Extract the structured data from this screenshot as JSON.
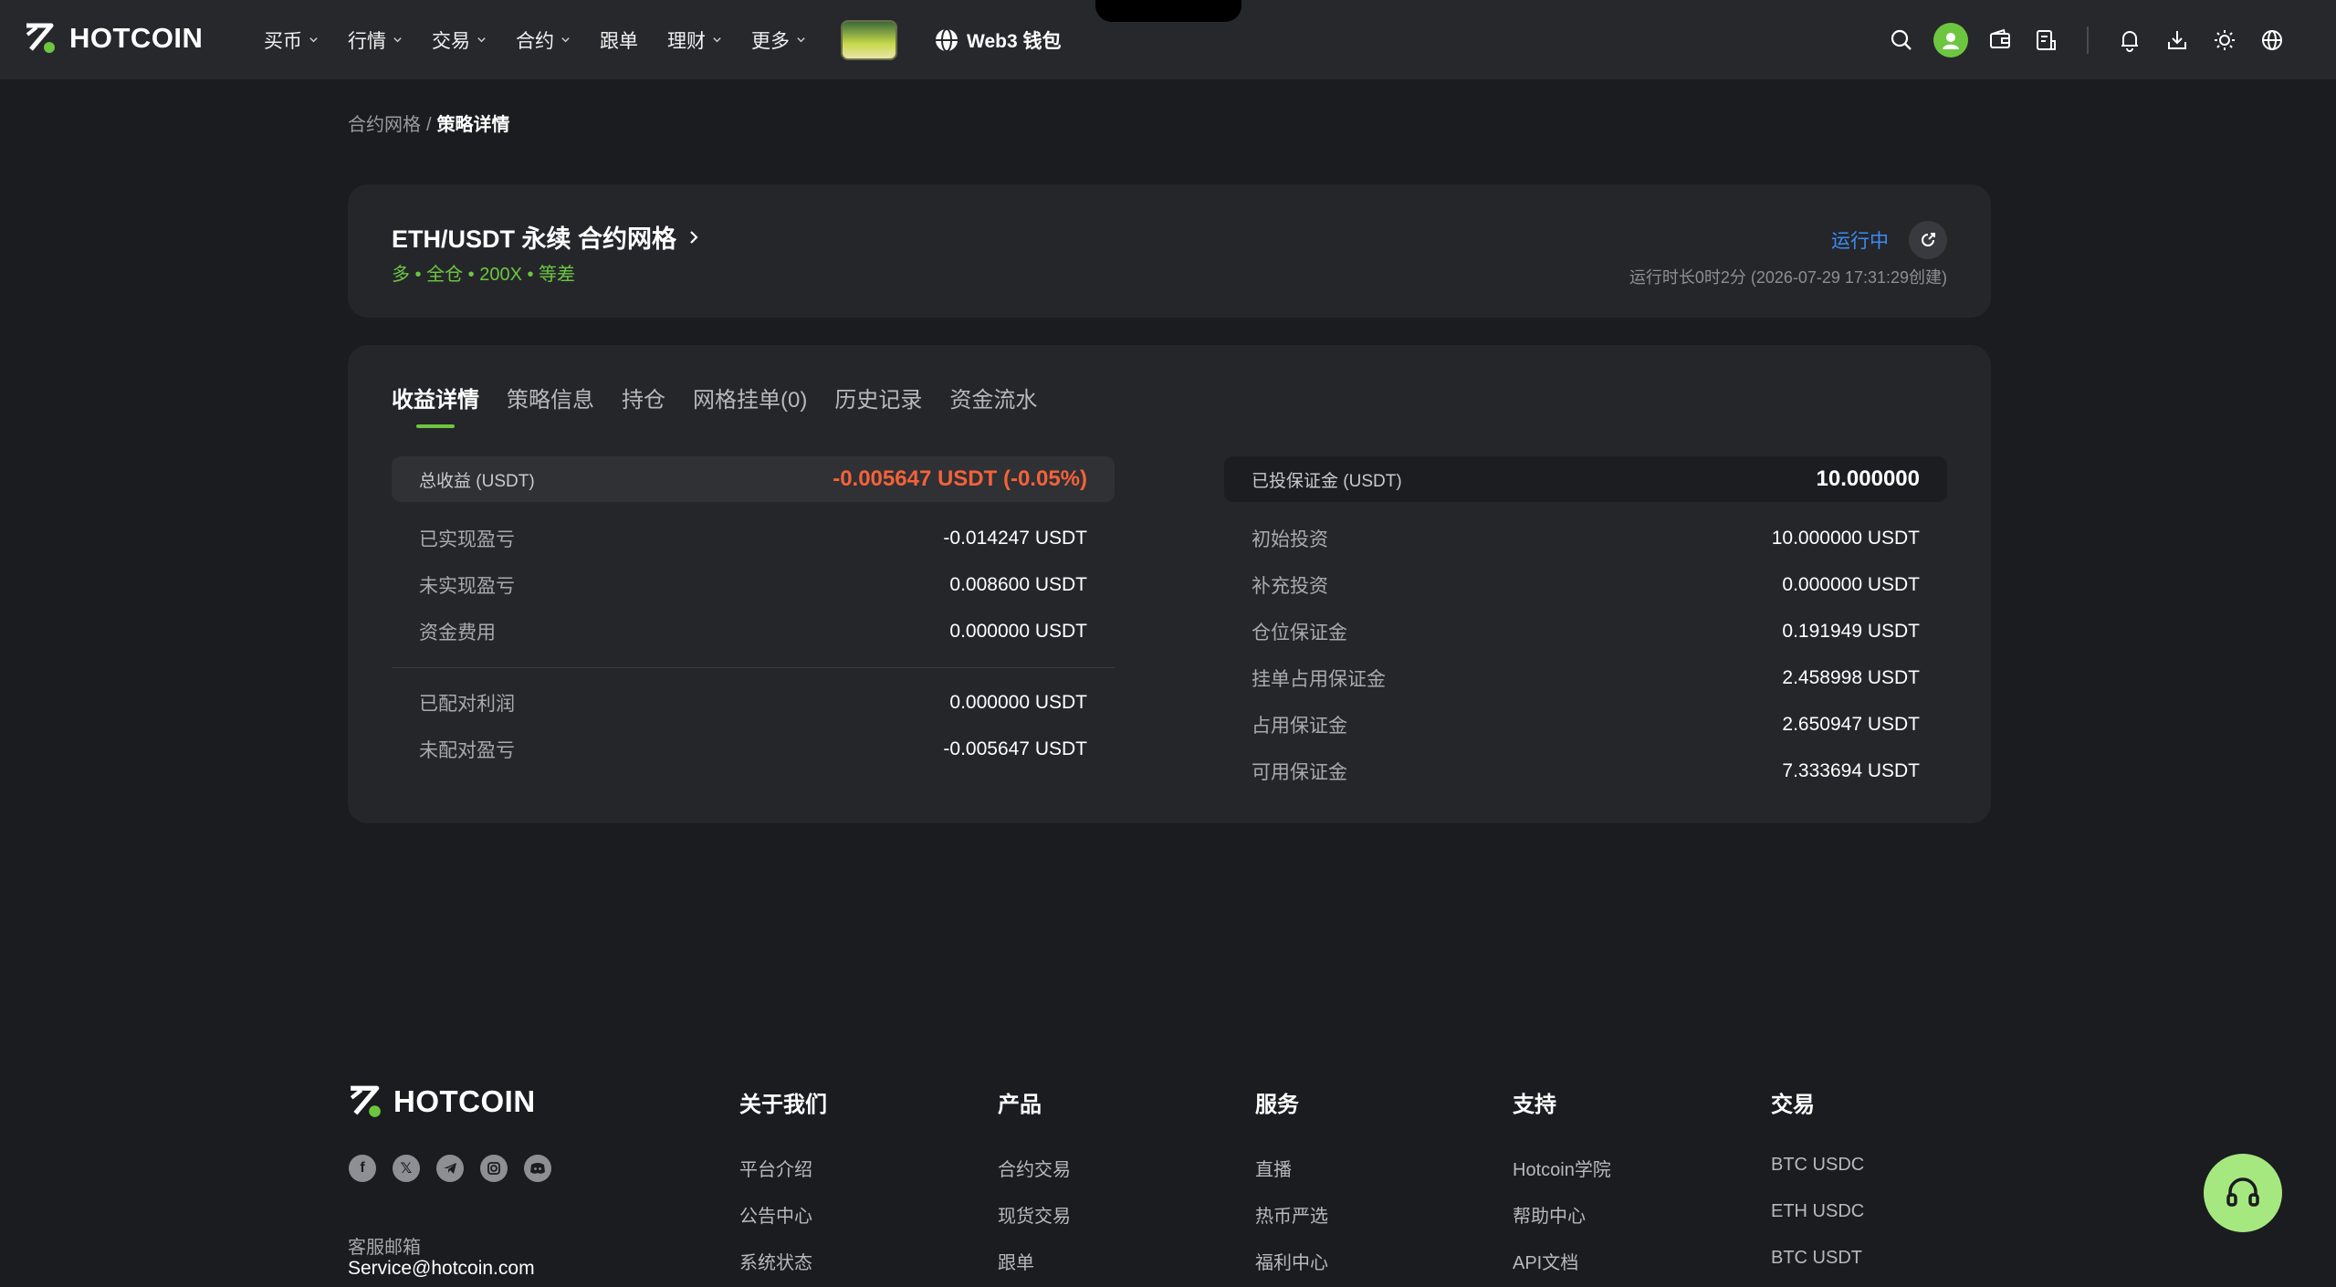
{
  "header": {
    "logo_text": "HOTCOIN",
    "nav": [
      {
        "label": "买币",
        "has_dropdown": true
      },
      {
        "label": "行情",
        "has_dropdown": true
      },
      {
        "label": "交易",
        "has_dropdown": true
      },
      {
        "label": "合约",
        "has_dropdown": true
      },
      {
        "label": "跟单",
        "has_dropdown": false
      },
      {
        "label": "理财",
        "has_dropdown": true
      },
      {
        "label": "更多",
        "has_dropdown": true
      }
    ],
    "web3_label": "Web3 钱包",
    "icons": [
      "search-icon",
      "avatar",
      "wallet-icon",
      "orders-icon",
      "bell-icon",
      "download-icon",
      "theme-icon",
      "globe-icon"
    ]
  },
  "breadcrumb": {
    "parent": "合约网格",
    "separator": "/",
    "current": "策略详情"
  },
  "summary": {
    "title": "ETH/USDT 永续 合约网格",
    "subtitle": "多 • 全仓 • 200X • 等差",
    "status": "运行中",
    "runtime": "运行时长0时2分 (2026-07-29 17:31:29创建)"
  },
  "tabs": [
    {
      "label": "收益详情",
      "active": true
    },
    {
      "label": "策略信息",
      "active": false
    },
    {
      "label": "持仓",
      "active": false
    },
    {
      "label": "网格挂单(0)",
      "active": false
    },
    {
      "label": "历史记录",
      "active": false
    },
    {
      "label": "资金流水",
      "active": false
    }
  ],
  "profit": {
    "total_label": "总收益 (USDT)",
    "total_value": "-0.005647 USDT (-0.05%)",
    "rows": [
      {
        "label": "已实现盈亏",
        "value": "-0.014247 USDT"
      },
      {
        "label": "未实现盈亏",
        "value": "0.008600 USDT"
      },
      {
        "label": "资金费用",
        "value": "0.000000 USDT"
      }
    ],
    "rows2": [
      {
        "label": "已配对利润",
        "value": "0.000000 USDT"
      },
      {
        "label": "未配对盈亏",
        "value": "-0.005647 USDT"
      }
    ]
  },
  "margin": {
    "total_label": "已投保证金 (USDT)",
    "total_value": "10.000000",
    "rows": [
      {
        "label": "初始投资",
        "value": "10.000000 USDT"
      },
      {
        "label": "补充投资",
        "value": "0.000000 USDT"
      },
      {
        "label": "仓位保证金",
        "value": "0.191949 USDT"
      },
      {
        "label": "挂单占用保证金",
        "value": "2.458998 USDT"
      },
      {
        "label": "占用保证金",
        "value": "2.650947 USDT"
      },
      {
        "label": "可用保证金",
        "value": "7.333694 USDT"
      }
    ]
  },
  "footer": {
    "logo_text": "HOTCOIN",
    "socials": [
      "facebook-icon",
      "x-icon",
      "telegram-icon",
      "instagram-icon",
      "discord-icon"
    ],
    "contact_label": "客服邮箱",
    "contact_email": "Service@hotcoin.com",
    "columns": [
      {
        "title": "关于我们",
        "links": [
          "平台介绍",
          "公告中心",
          "系统状态"
        ]
      },
      {
        "title": "产品",
        "links": [
          "合约交易",
          "现货交易",
          "跟单"
        ]
      },
      {
        "title": "服务",
        "links": [
          "直播",
          "热币严选",
          "福利中心"
        ]
      },
      {
        "title": "支持",
        "links": [
          "Hotcoin学院",
          "帮助中心",
          "API文档"
        ]
      },
      {
        "title": "交易",
        "links": [
          "BTC USDC",
          "ETH USDC",
          "BTC USDT"
        ]
      }
    ]
  },
  "colors": {
    "accent_green": "#6dc640",
    "loss_red": "#f4623a",
    "status_blue": "#3d8bf5"
  }
}
